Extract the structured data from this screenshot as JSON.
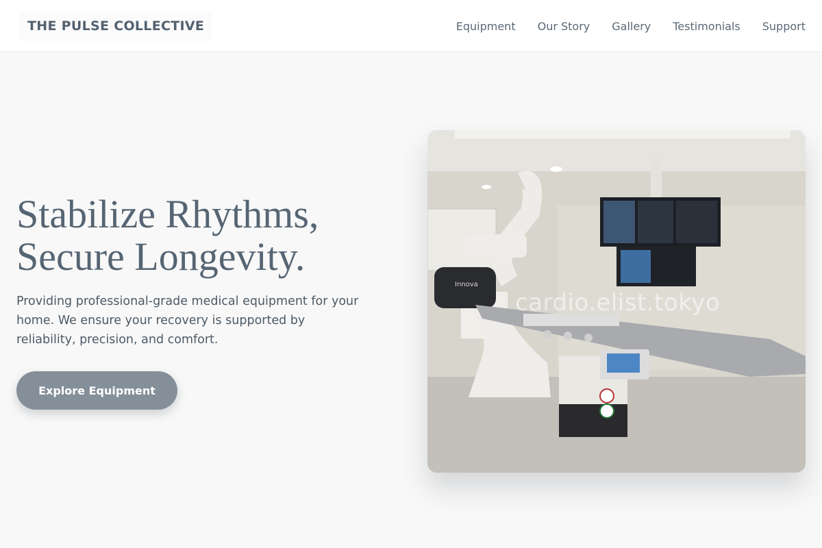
{
  "header": {
    "brand": "THE PULSE COLLECTIVE",
    "nav": [
      "Equipment",
      "Our Story",
      "Gallery",
      "Testimonials",
      "Support"
    ]
  },
  "hero": {
    "title_line1": "Stabilize Rhythms,",
    "title_line2": "Secure Longevity.",
    "description": "Providing professional-grade medical equipment for your home. We ensure your recovery is supported by reliability, precision, and comfort.",
    "cta_label": "Explore Equipment",
    "image": {
      "subject": "cardiac catheterization lab with imaging equipment",
      "watermark": "cardio.elist.tokyo",
      "machine_label": "Innova"
    }
  },
  "colors": {
    "background": "#f8f8f8",
    "header_bg": "#ffffff",
    "text": "#566573",
    "button_bg": "#848f99",
    "button_text": "#ffffff"
  }
}
